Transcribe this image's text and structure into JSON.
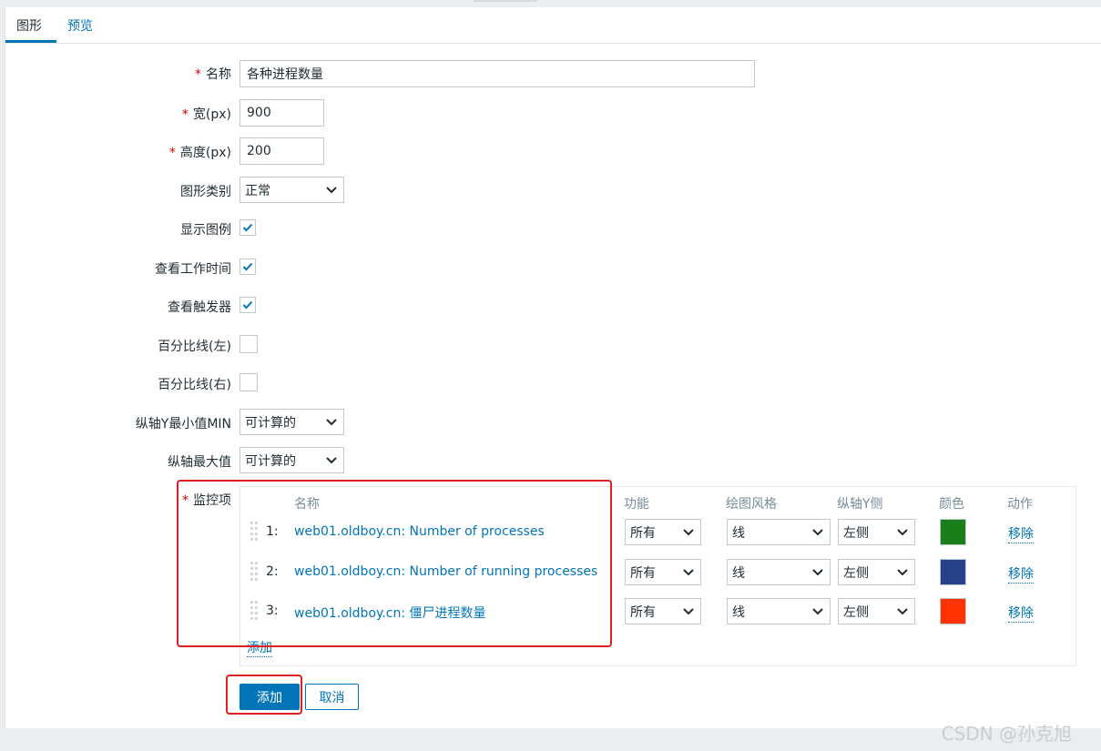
{
  "tabs": [
    {
      "label": "图形",
      "active": true
    },
    {
      "label": "预览",
      "active": false
    }
  ],
  "form": {
    "required_mark": "*",
    "name": {
      "label": "名称",
      "value": "各种进程数量"
    },
    "width": {
      "label": "宽(px)",
      "value": "900"
    },
    "height": {
      "label": "高度(px)",
      "value": "200"
    },
    "graph_type": {
      "label": "图形类别",
      "value": "正常"
    },
    "show_legend": {
      "label": "显示图例",
      "checked": true
    },
    "show_working_time": {
      "label": "查看工作时间",
      "checked": true
    },
    "show_triggers": {
      "label": "查看触发器",
      "checked": true
    },
    "percentile_left": {
      "label": "百分比线(左)",
      "checked": false
    },
    "percentile_right": {
      "label": "百分比线(右)",
      "checked": false
    },
    "y_min": {
      "label": "纵轴Y最小值MIN",
      "value": "可计算的"
    },
    "y_max": {
      "label": "纵轴最大值",
      "value": "可计算的"
    }
  },
  "items": {
    "label": "监控项",
    "columns": [
      "名称",
      "功能",
      "绘图风格",
      "纵轴Y侧",
      "颜色",
      "动作"
    ],
    "rows": [
      {
        "num": "1:",
        "name": "web01.oldboy.cn: Number of processes",
        "function": "所有",
        "style": "线",
        "yaxis": "左侧",
        "color": "#1a7f1a",
        "action": "移除"
      },
      {
        "num": "2:",
        "name": "web01.oldboy.cn: Number of running processes",
        "function": "所有",
        "style": "线",
        "yaxis": "左侧",
        "color": "#27428a",
        "action": "移除"
      },
      {
        "num": "3:",
        "name": "web01.oldboy.cn: 僵尸进程数量",
        "function": "所有",
        "style": "线",
        "yaxis": "左侧",
        "color": "#ff3300",
        "action": "移除"
      }
    ],
    "add_link": "添加"
  },
  "buttons": {
    "submit": "添加",
    "cancel": "取消"
  },
  "watermark": "CSDN @孙克旭",
  "colors": {
    "accent": "#0275b8",
    "highlight": "#e02020",
    "required": "#d40000"
  }
}
